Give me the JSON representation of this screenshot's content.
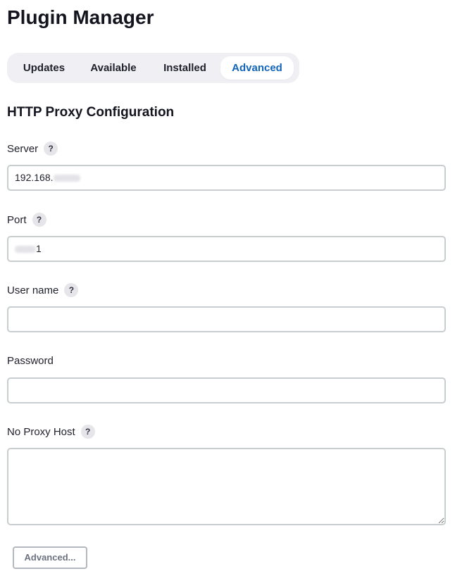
{
  "page": {
    "title": "Plugin Manager"
  },
  "tabs": [
    {
      "label": "Updates",
      "active": false
    },
    {
      "label": "Available",
      "active": false
    },
    {
      "label": "Installed",
      "active": false
    },
    {
      "label": "Advanced",
      "active": true
    }
  ],
  "section": {
    "title": "HTTP Proxy Configuration"
  },
  "fields": {
    "server": {
      "label": "Server",
      "value_visible": "192.168.",
      "value_partially_obscured": true,
      "has_help": true
    },
    "port": {
      "label": "Port",
      "value_visible": "1",
      "value_partially_obscured": true,
      "has_help": true
    },
    "username": {
      "label": "User name",
      "value": "",
      "has_help": true
    },
    "password": {
      "label": "Password",
      "value": "",
      "has_help": false
    },
    "no_proxy_host": {
      "label": "No Proxy Host",
      "value": "",
      "has_help": true
    }
  },
  "help_icon_glyph": "?",
  "buttons": {
    "advanced_label": "Advanced..."
  },
  "colors": {
    "active_tab_text": "#1264b8",
    "tab_bar_bg": "#f0f0f4",
    "field_border": "#c8cdd0"
  }
}
